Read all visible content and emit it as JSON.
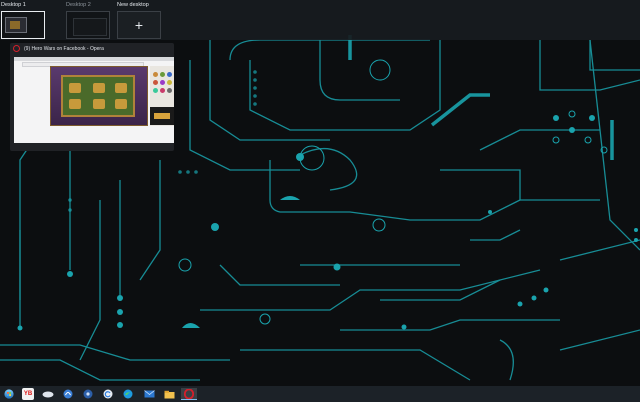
{
  "desktops": [
    {
      "label": "Desktop 1",
      "active": true
    },
    {
      "label": "Desktop 2",
      "active": false
    },
    {
      "label": "New desktop",
      "icon": "plus-icon"
    }
  ],
  "window_preview": {
    "app_icon": "opera-icon",
    "title": "(9) Hero Wars on Facebook - Opera"
  },
  "taskbar": {
    "items": [
      {
        "name": "start-icon"
      },
      {
        "name": "yandex-browser-icon",
        "label": "YB"
      },
      {
        "name": "cloud-app-icon"
      },
      {
        "name": "headset-app-icon"
      },
      {
        "name": "disk-tool-icon"
      },
      {
        "name": "refresh-app-icon"
      },
      {
        "name": "edge-icon"
      },
      {
        "name": "mail-icon"
      },
      {
        "name": "file-explorer-icon"
      },
      {
        "name": "opera-taskbar-icon"
      }
    ],
    "tray_time": "",
    "tray_date": ""
  },
  "colors": {
    "accent": "#1aa3ad",
    "accent_dim": "#147a82",
    "background": "#0c0e10",
    "opera_red": "#d51f2b"
  }
}
